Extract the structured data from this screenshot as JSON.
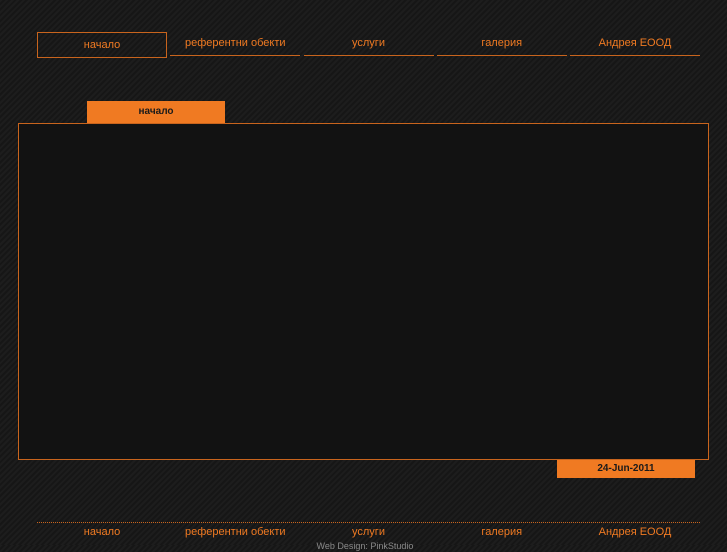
{
  "top_nav": [
    {
      "label": "начало",
      "active": true
    },
    {
      "label": "референтни обекти",
      "active": false
    },
    {
      "label": "услуги",
      "active": false
    },
    {
      "label": "галерия",
      "active": false
    },
    {
      "label": "Андрея ЕООД",
      "active": false
    }
  ],
  "page_tab": {
    "label": "начало"
  },
  "date_badge": {
    "text": "24-Jun-2011"
  },
  "footer_nav": [
    {
      "label": "начало"
    },
    {
      "label": "референтни обекти"
    },
    {
      "label": "услуги"
    },
    {
      "label": "галерия"
    },
    {
      "label": "Андрея ЕООД"
    }
  ],
  "credit": {
    "text": "Web Design: PinkStudio"
  },
  "colors": {
    "accent": "#f07a22",
    "background": "#1b1b1b",
    "panel": "#121212",
    "border": "#c8641d"
  }
}
